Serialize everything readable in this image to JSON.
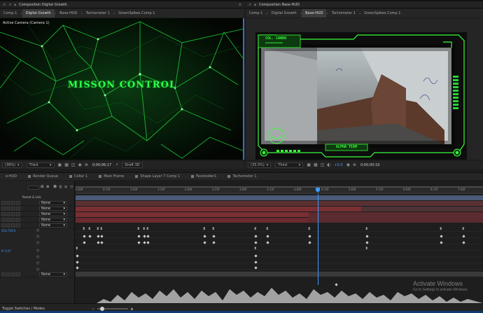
{
  "colors": {
    "accent": "#3d9bff",
    "hud_green": "#39ff3a",
    "layer_red": "#7a2f33",
    "layer_red_dark": "#4a2a2e",
    "playhead": "#3d9bff"
  },
  "left_panel": {
    "header_label": "Composition Digital Growth",
    "tabs": [
      {
        "label": "Comp 1",
        "active": false
      },
      {
        "label": "Digital Growth",
        "active": true
      },
      {
        "label": "Base-HUD",
        "active": false
      },
      {
        "label": "Tachometer 1",
        "active": false
      },
      {
        "label": "GreenSpikes Comp 1",
        "active": false
      }
    ],
    "camera_label": "Active Camera (Camera 1)",
    "viewer_title": "MISSON CONTROL",
    "zoom": "(39%)",
    "resolution": "Third",
    "timecode": "0;00;06;17",
    "renderer": "Draft 3D"
  },
  "right_panel": {
    "header_label": "Composition Base-HUD",
    "tabs": [
      {
        "label": "Comp 1",
        "active": false
      },
      {
        "label": "Digital Growth",
        "active": false
      },
      {
        "label": "Base-HUD",
        "active": true
      },
      {
        "label": "Tachometer 1",
        "active": false
      },
      {
        "label": "GreenSpikes Comp 1",
        "active": false
      }
    ],
    "hud_top_title": "COL. CANDO",
    "hud_top_sub": "▪▪▪▪▪▪▪▪▪▪",
    "hud_bottom_title": "ALPHA TEAM",
    "zoom": "(33.3%)",
    "resolution": "Third",
    "exposure": "+0.0",
    "timecode": "0;00;00;19"
  },
  "timeline": {
    "tabs": [
      "e-HUD",
      "Render Queue",
      "Collar 1",
      "Main Frame",
      "Shape Layer 7 Comp 1",
      "Facetolder1",
      "Tachometer 1"
    ],
    "layer_header": "Parent & Link",
    "parent_values": [
      "None",
      "None",
      "None",
      "None",
      "None",
      "None"
    ],
    "property_values": [
      "410,729,0",
      "0°,0,0°"
    ],
    "bottom_parent": "None",
    "ruler_ticks": [
      "0:00f",
      "0:15f",
      "1:00f",
      "1:15f",
      "2:00f",
      "2:15f",
      "3:00f",
      "3:15f",
      "4:00f",
      "4:15f",
      "5:00f",
      "5:15f",
      "6:00f",
      "6:15f",
      "7:00f"
    ],
    "playhead_fraction": 0.595
  },
  "footer": {
    "left_label": "Toggle Switches / Modes"
  },
  "watermark": {
    "title": "Activate Windows",
    "subtitle": "Go to Settings to activate Windows."
  }
}
